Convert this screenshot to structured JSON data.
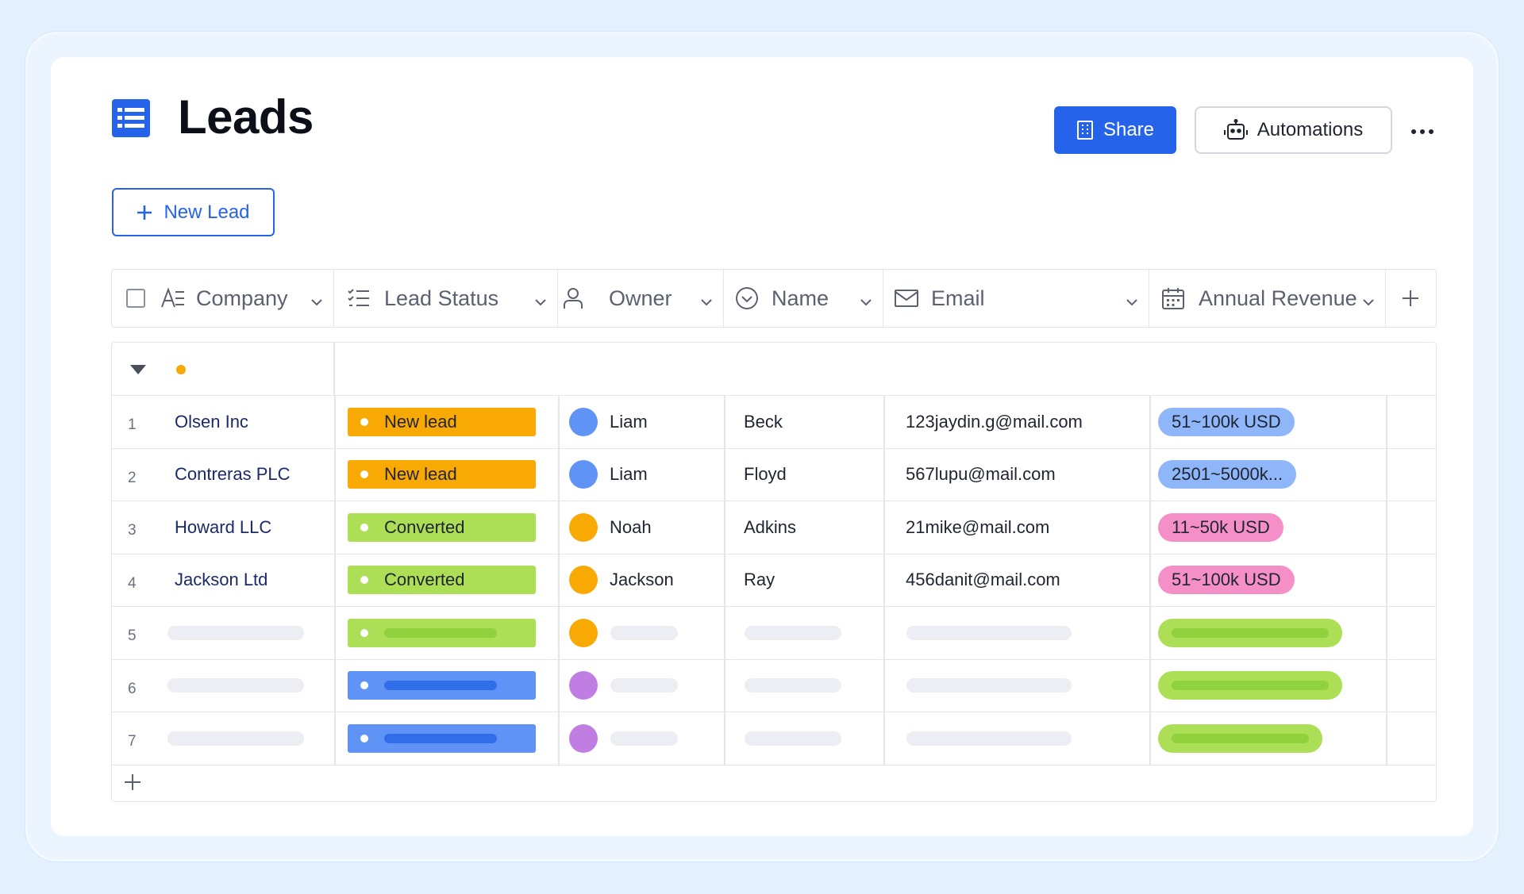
{
  "page": {
    "title": "Leads",
    "accent_color": "#2563eb"
  },
  "toolbar": {
    "share_label": "Share",
    "automations_label": "Automations",
    "new_lead_label": "New Lead"
  },
  "columns": [
    {
      "key": "company",
      "label": "Company",
      "icon": "text-type-icon"
    },
    {
      "key": "lead_status",
      "label": "Lead Status",
      "icon": "checklist-icon"
    },
    {
      "key": "owner",
      "label": "Owner",
      "icon": "person-icon"
    },
    {
      "key": "name",
      "label": "Name",
      "icon": "check-circle-icon"
    },
    {
      "key": "email",
      "label": "Email",
      "icon": "mail-icon"
    },
    {
      "key": "annual_revenue",
      "label": "Annual Revenue",
      "icon": "calendar-icon"
    }
  ],
  "colors": {
    "status_new_lead": "#f8a904",
    "status_converted": "#acdf56",
    "status_blue": "#5f93f5",
    "avatar_blue": "#5f93f5",
    "avatar_orange": "#f8a904",
    "avatar_purple": "#c07ee2",
    "rev_blue": "#8fb6f8",
    "rev_pink": "#f58fc7",
    "rev_green": "#acdf56",
    "group_dot": "#f8a904"
  },
  "rows": [
    {
      "num": "1",
      "company": "Olsen Inc",
      "status": "New lead",
      "status_color": "#f8a904",
      "owner": "Liam",
      "owner_color": "#5f93f5",
      "name": "Beck",
      "email": "123jaydin.g@mail.com",
      "revenue": "51~100k USD",
      "revenue_color": "#8fb6f8"
    },
    {
      "num": "2",
      "company": "Contreras PLC",
      "status": "New lead",
      "status_color": "#f8a904",
      "owner": "Liam",
      "owner_color": "#5f93f5",
      "name": "Floyd",
      "email": "567lupu@mail.com",
      "revenue": "2501~5000k...",
      "revenue_color": "#8fb6f8"
    },
    {
      "num": "3",
      "company": "Howard LLC",
      "status": "Converted",
      "status_color": "#acdf56",
      "owner": "Noah",
      "owner_color": "#f8a904",
      "name": "Adkins",
      "email": "21mike@mail.com",
      "revenue": "11~50k USD",
      "revenue_color": "#f58fc7"
    },
    {
      "num": "4",
      "company": "Jackson Ltd",
      "status": "Converted",
      "status_color": "#acdf56",
      "owner": "Jackson",
      "owner_color": "#f8a904",
      "name": "Ray",
      "email": "456danit@mail.com",
      "revenue": "51~100k USD",
      "revenue_color": "#f58fc7"
    }
  ],
  "placeholder_rows": [
    {
      "num": "5",
      "status_color": "#acdf56",
      "status_inner": "#8fd23e",
      "owner_color": "#f8a904",
      "revenue_color": "#acdf56",
      "revenue_inner": "#8fd23e"
    },
    {
      "num": "6",
      "status_color": "#5f93f5",
      "status_inner": "#2f6ee8",
      "owner_color": "#c07ee2",
      "revenue_color": "#acdf56",
      "revenue_inner": "#8fd23e"
    },
    {
      "num": "7",
      "status_color": "#5f93f5",
      "status_inner": "#2f6ee8",
      "owner_color": "#c07ee2",
      "revenue_color": "#acdf56",
      "revenue_inner": "#8fd23e"
    }
  ]
}
